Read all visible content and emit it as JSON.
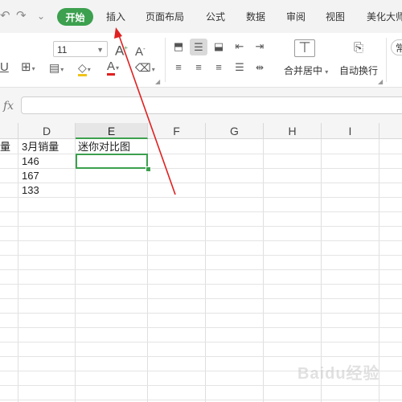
{
  "menu": {
    "quick_icons": [
      "undo-icon",
      "redo-icon",
      "quick-access-dropdown-icon"
    ],
    "tabs": [
      "开始",
      "插入",
      "页面布局",
      "公式",
      "数据",
      "审阅",
      "视图",
      "美化大师"
    ]
  },
  "ribbon": {
    "font_size": "11",
    "grow_font": "A",
    "shrink_font": "A",
    "font_color_letter": "A",
    "font_color_hex": "#e02020",
    "highlight_color_hex": "#f0c419",
    "merge_center_label": "合并居中",
    "wrap_text_label": "自动换行",
    "number_format_partial": "常"
  },
  "formula_bar": {
    "fx_label": "fx",
    "value": ""
  },
  "sheet": {
    "columns": [
      "D",
      "E",
      "F",
      "G",
      "H",
      "I"
    ],
    "active_column": "E",
    "rows": [
      {
        "c": "量",
        "d": "3月销量",
        "e": "迷你对比图"
      },
      {
        "c": "",
        "d": "146",
        "e": ""
      },
      {
        "c": "",
        "d": "167",
        "e": ""
      },
      {
        "c": "",
        "d": "133",
        "e": ""
      }
    ]
  },
  "watermark": {
    "text": "Baidu经验"
  },
  "colors": {
    "accent_green": "#3ca04e",
    "arrow_red": "#e02020"
  }
}
